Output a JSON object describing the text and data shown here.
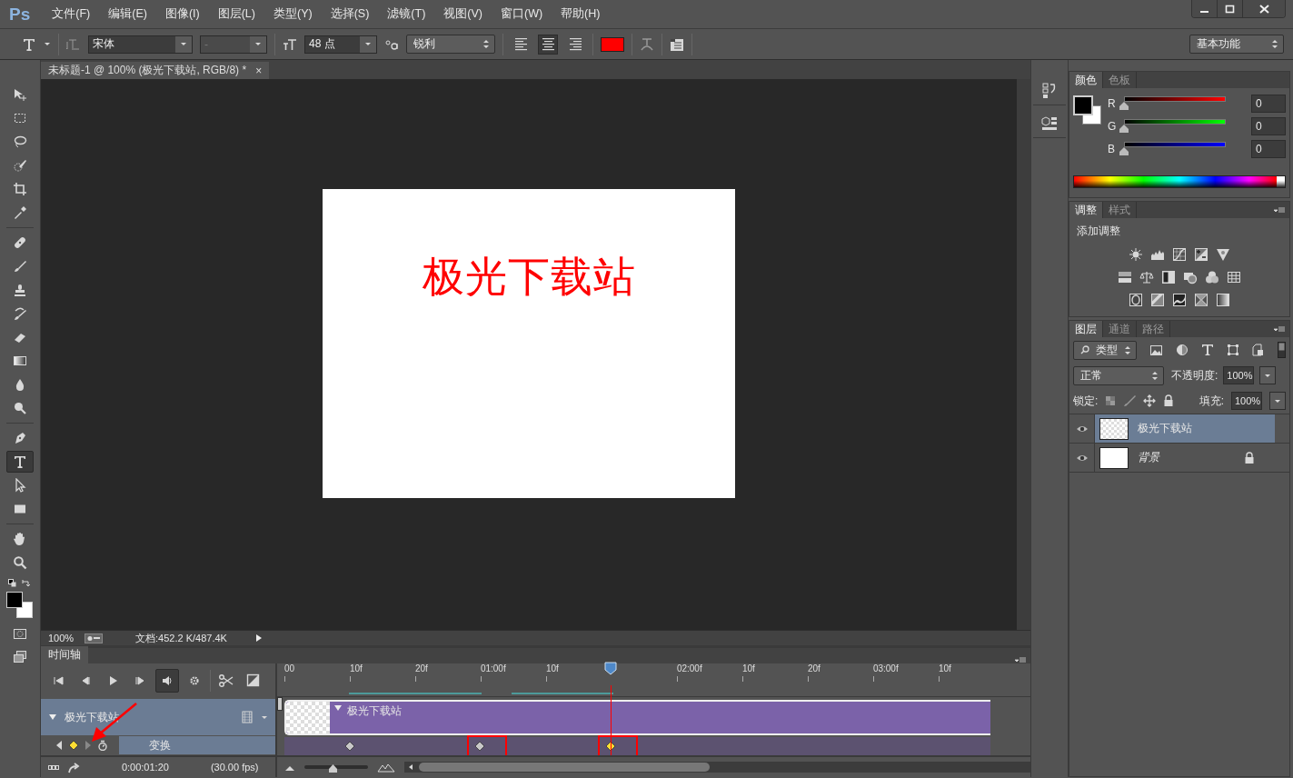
{
  "app": {
    "logo": "Ps"
  },
  "menu": [
    "文件(F)",
    "编辑(E)",
    "图像(I)",
    "图层(L)",
    "类型(Y)",
    "选择(S)",
    "滤镜(T)",
    "视图(V)",
    "窗口(W)",
    "帮助(H)"
  ],
  "options_bar": {
    "font_family": "宋体",
    "font_style": "-",
    "font_style_disabled": true,
    "font_size": "48 点",
    "antialias": "锐利",
    "align": [
      {
        "selected": false
      },
      {
        "selected": true
      },
      {
        "selected": false
      }
    ],
    "workspace": "基本功能"
  },
  "document_tab": {
    "title": "未标题-1 @ 100% (极光下载站, RGB/8) *",
    "close": "×"
  },
  "tools": [
    {
      "selected": false
    },
    {
      "selected": false
    },
    {
      "selected": false
    },
    {
      "selected": false
    },
    {
      "selected": false
    },
    {
      "selected": false
    },
    {
      "selected": false
    },
    {
      "selected": false
    },
    {
      "selected": false
    },
    {
      "selected": false
    },
    {
      "selected": false
    },
    {
      "selected": false
    },
    {
      "selected": false
    },
    {
      "selected": false
    },
    {
      "selected": false
    },
    {
      "selected": true
    },
    {
      "selected": false
    },
    {
      "selected": false
    },
    {
      "selected": false
    },
    {
      "selected": false
    }
  ],
  "canvas": {
    "text": "极光下载站"
  },
  "status_bar": {
    "zoom": "100%",
    "doc_info": "文档:452.2 K/487.4K"
  },
  "timeline": {
    "tab": "时间轴",
    "controls": [
      {
        "selected": false
      },
      {
        "selected": false
      },
      {
        "selected": false
      },
      {
        "selected": false
      },
      {
        "selected": true
      },
      {
        "selected": false
      }
    ],
    "ruler": [
      "00",
      "10f",
      "20f",
      "01:00f",
      "10f",
      "02:00f",
      "10f",
      "20f",
      "03:00f",
      "10f"
    ],
    "layer": {
      "name": "极光下载站",
      "expanded": true,
      "clip_label": "极光下载站"
    },
    "property": {
      "name": "变换",
      "keyframes": [
        {
          "selected": false,
          "highlighted": false
        },
        {
          "selected": false,
          "highlighted": true
        },
        {
          "selected": true,
          "highlighted": true
        }
      ]
    },
    "current_time": "0:00:01:20",
    "frame_rate": "(30.00 fps)",
    "zoom": {
      "level": 0.45
    }
  },
  "color_panel": {
    "tabs": [
      {
        "label": "颜色",
        "selected": true
      },
      {
        "label": "色板",
        "selected": false
      }
    ],
    "channels": [
      {
        "label": "R",
        "value": "0",
        "level": 0
      },
      {
        "label": "G",
        "value": "0",
        "level": 0
      },
      {
        "label": "B",
        "value": "0",
        "level": 0
      }
    ]
  },
  "adjustments_panel": {
    "tabs": [
      {
        "label": "调整",
        "selected": true
      },
      {
        "label": "样式",
        "selected": false
      }
    ],
    "heading": "添加调整"
  },
  "layers_panel": {
    "tabs": [
      {
        "label": "图层",
        "selected": true
      },
      {
        "label": "通道",
        "selected": false
      },
      {
        "label": "路径",
        "selected": false
      }
    ],
    "filter": "类型",
    "blend_mode": "正常",
    "opacity_label": "不透明度:",
    "opacity": "100%",
    "lock_label": "锁定:",
    "fill_label": "填充:",
    "fill": "100%",
    "layers": [
      {
        "name": "极光下载站",
        "kind": "text",
        "selected": true,
        "visible": true,
        "locked": false
      },
      {
        "name": "背景",
        "kind": "background",
        "selected": false,
        "visible": true,
        "locked": true
      }
    ]
  }
}
